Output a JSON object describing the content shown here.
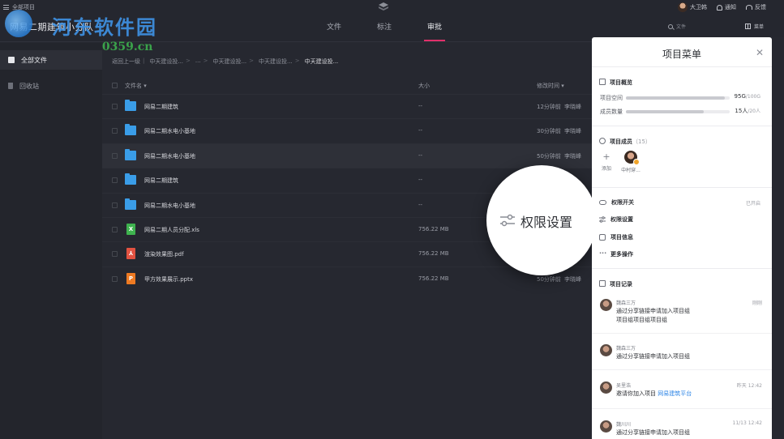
{
  "topbar": {
    "all_projects": "全部项目",
    "project_title": "网易二期建筑小分队",
    "tabs": [
      "文件",
      "标注",
      "审批"
    ],
    "active_tab": "审批",
    "user_name": "大卫韩",
    "notify_label": "通知",
    "feedback_label": "反馈",
    "search_label": "文件",
    "menu_label": "菜单"
  },
  "watermark": {
    "title": "河东软件园",
    "url": "www.pc0359.cn"
  },
  "sidebar": {
    "items": [
      {
        "label": "全部文件",
        "icon": "files-icon",
        "active": true
      },
      {
        "label": "回收站",
        "icon": "trash-icon",
        "active": false
      }
    ]
  },
  "breadcrumb": {
    "items": [
      "返回上一级",
      "中天建设投...",
      "...",
      "中天建设投...",
      "中天建设投...",
      "中天建设投..."
    ]
  },
  "table": {
    "columns": {
      "name": "文件名",
      "size": "大小",
      "time": "修改时间"
    },
    "rows": [
      {
        "type": "folder",
        "name": "网易二期建筑",
        "size": "--",
        "time": "12分钟前",
        "user": "李晓峰"
      },
      {
        "type": "folder",
        "name": "网易二期水电小基地",
        "size": "--",
        "time": "30分钟前",
        "user": "李晓峰"
      },
      {
        "type": "folder",
        "name": "网易二期水电小基地",
        "size": "--",
        "time": "50分钟前",
        "user": "李晓峰"
      },
      {
        "type": "folder",
        "name": "网易二期建筑",
        "size": "--",
        "time": "",
        "user": ""
      },
      {
        "type": "folder",
        "name": "网易二期水电小基地",
        "size": "--",
        "time": "",
        "user": ""
      },
      {
        "type": "xls",
        "glyph": "X",
        "name": "网易二期人员分配.xls",
        "size": "756.22 MB",
        "time": "",
        "user": ""
      },
      {
        "type": "pdf",
        "glyph": "⅄",
        "name": "渲染效果图.pdf",
        "size": "756.22 MB",
        "time": "",
        "user": ""
      },
      {
        "type": "ppt",
        "glyph": "P",
        "name": "甲方效果展示.pptx",
        "size": "756.22 MB",
        "time": "50分钟前",
        "user": "李晓峰"
      }
    ]
  },
  "callout": {
    "text": "权限设置"
  },
  "panel": {
    "title": "项目菜单",
    "overview_title": "项目概览",
    "space_label": "项目空间",
    "space_value": "95G",
    "space_total": "/100G",
    "space_fraction": 0.95,
    "members_label": "成员数量",
    "members_value": "15人",
    "members_total": "/20人",
    "members_fraction": 0.75,
    "members_title": "项目成员",
    "members_count": "（15）",
    "add_label": "添加",
    "member_name": "中村穿...",
    "menu": [
      {
        "label": "权限开关",
        "state": "已开启",
        "icon": "toggle-icon"
      },
      {
        "label": "权限设置",
        "state": "",
        "icon": "sliders-icon"
      },
      {
        "label": "项目信息",
        "state": "",
        "icon": "info-icon"
      },
      {
        "label": "更多操作",
        "state": "",
        "icon": "more-icon"
      }
    ],
    "log_title": "项目记录",
    "logs": [
      {
        "name": "魏森三万",
        "time": "刚刚",
        "lines": [
          "通过分享链接申请加入项目组",
          "项目组项目组项目组"
        ],
        "link": ""
      },
      {
        "name": "魏森三万",
        "time": "",
        "lines": [
          "通过分享链接申请加入项目组"
        ],
        "link": ""
      },
      {
        "name": "吴里浩",
        "time": "昨天 12:42",
        "lines": [
          "邀请你加入项目 "
        ],
        "link": "网易建筑平台"
      },
      {
        "name": "魏川川",
        "time": "11/13 12:42",
        "lines": [
          "通过分享链接申请加入项目组"
        ],
        "link": ""
      }
    ]
  }
}
